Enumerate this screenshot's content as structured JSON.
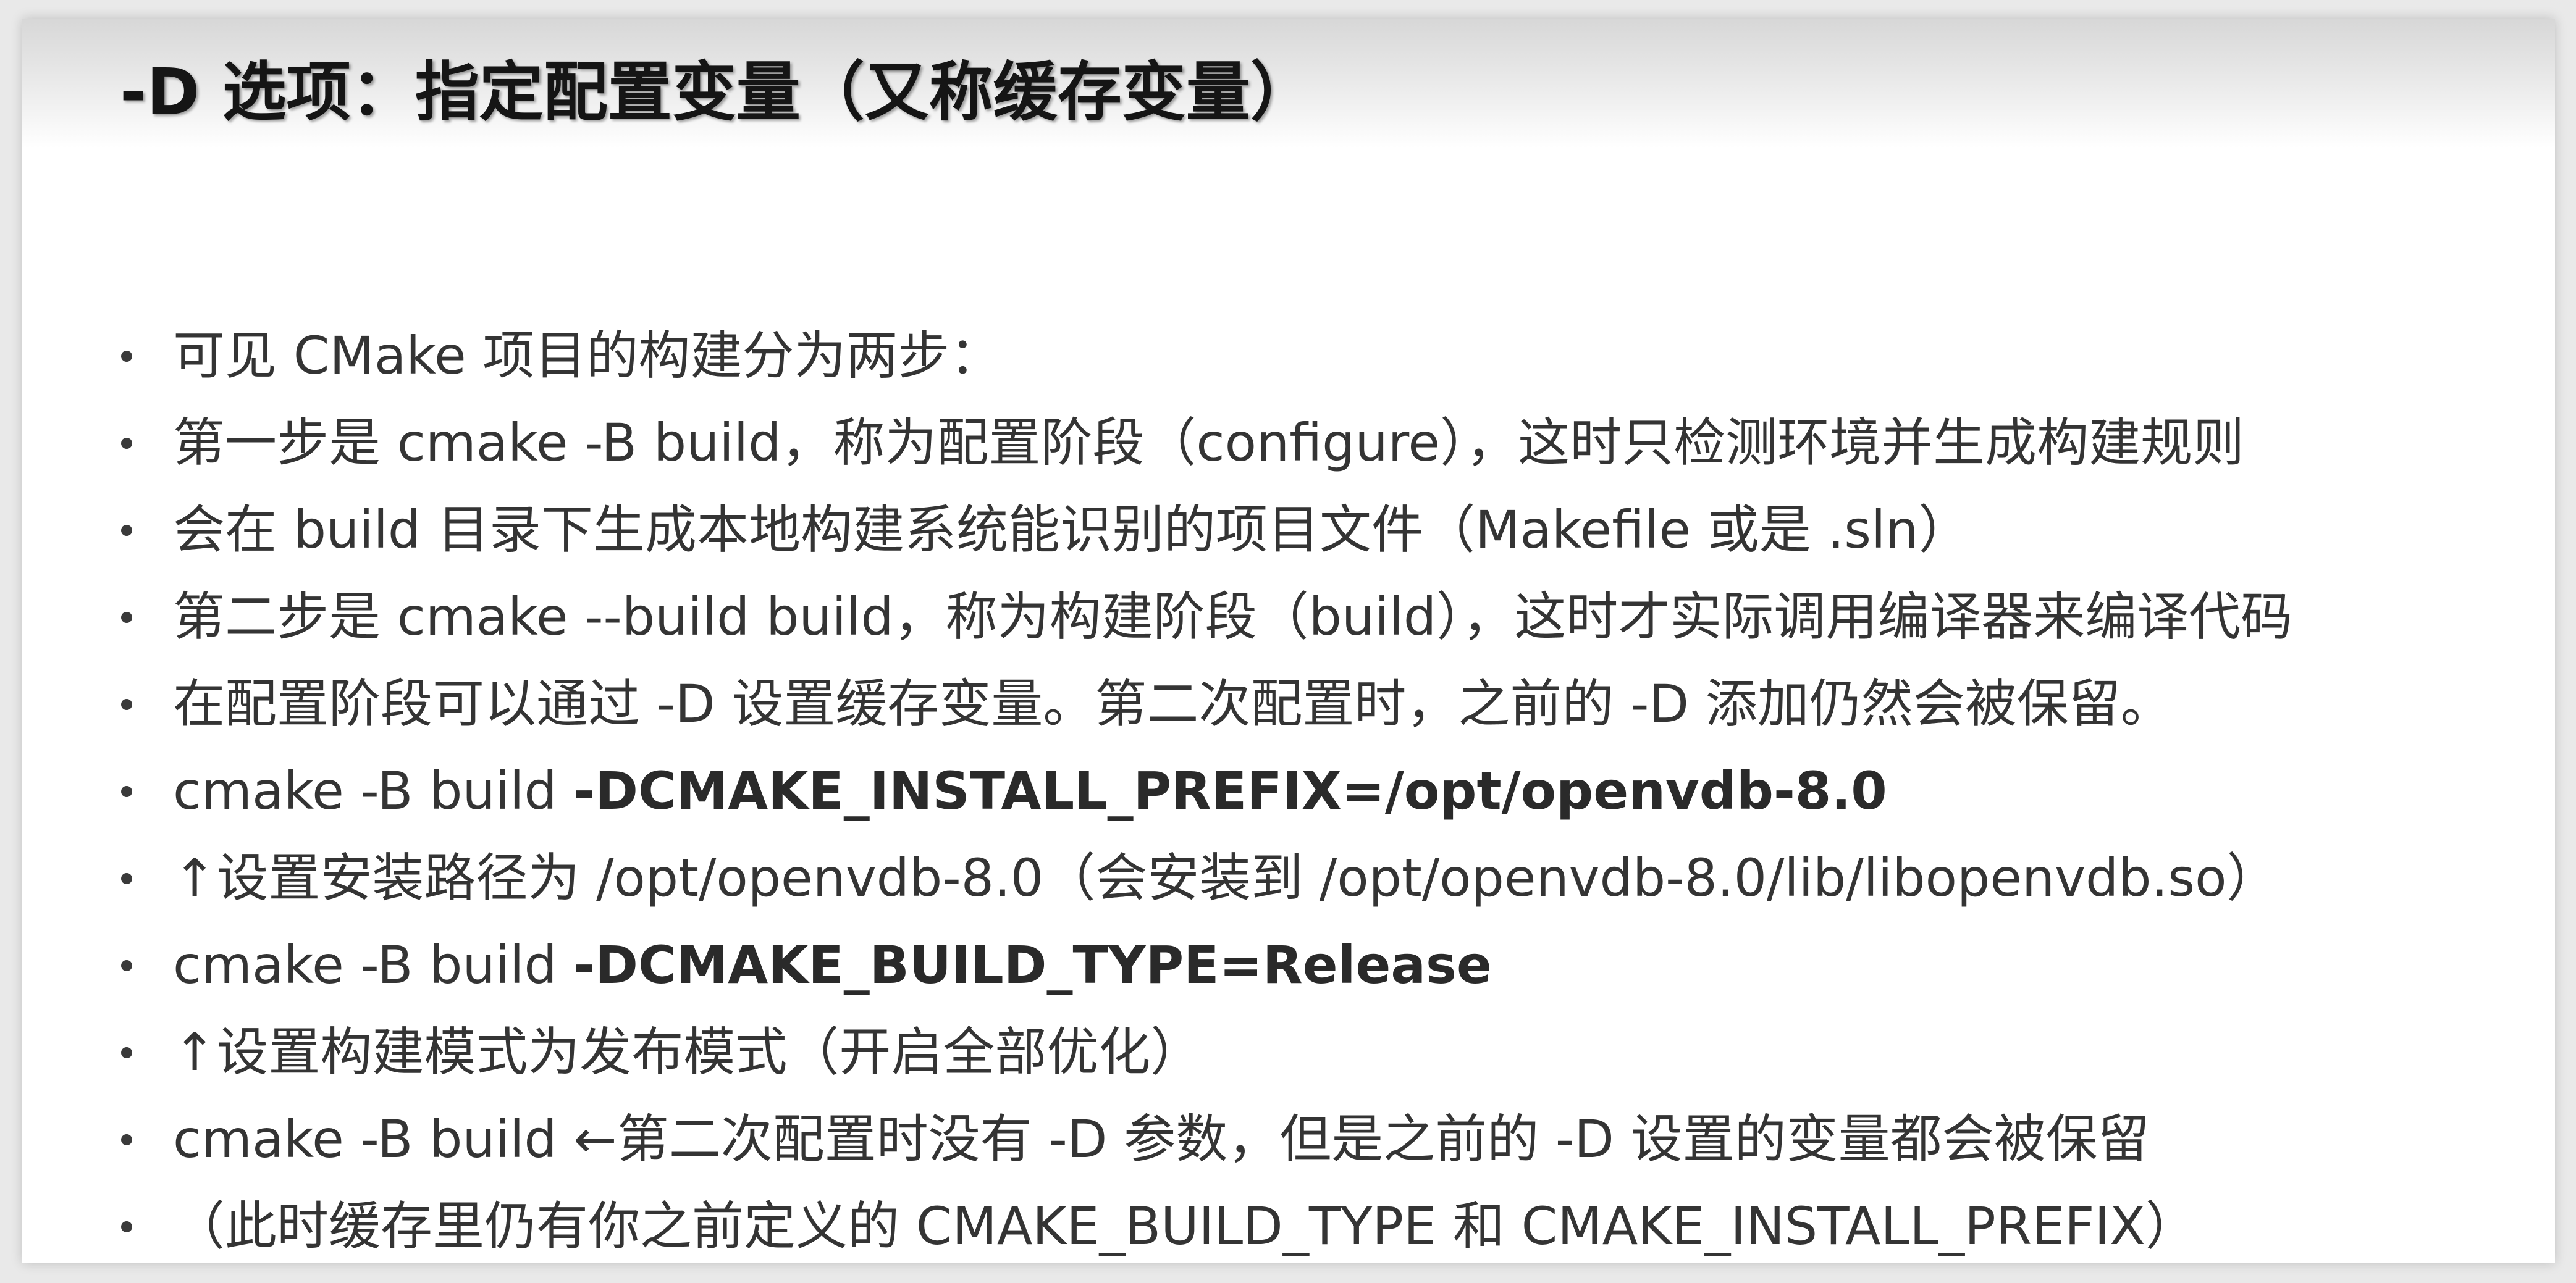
{
  "slide": {
    "title": "-D 选项：指定配置变量（又称缓存变量）",
    "bullets": [
      {
        "text": "可见 CMake 项目的构建分为两步：",
        "bold": ""
      },
      {
        "text": "第一步是 cmake -B build，称为配置阶段（configure），这时只检测环境并生成构建规则",
        "bold": ""
      },
      {
        "text": "会在 build 目录下生成本地构建系统能识别的项目文件（Makefile 或是 .sln）",
        "bold": ""
      },
      {
        "text": "第二步是 cmake --build build，称为构建阶段（build），这时才实际调用编译器来编译代码",
        "bold": ""
      },
      {
        "text": "在配置阶段可以通过 -D 设置缓存变量。第二次配置时，之前的 -D 添加仍然会被保留。",
        "bold": ""
      },
      {
        "text": "cmake -B build ",
        "bold": "-DCMAKE_INSTALL_PREFIX=/opt/openvdb-8.0"
      },
      {
        "text": "↑设置安装路径为 /opt/openvdb-8.0（会安装到 /opt/openvdb-8.0/lib/libopenvdb.so）",
        "bold": ""
      },
      {
        "text": "cmake -B build ",
        "bold": "-DCMAKE_BUILD_TYPE=Release"
      },
      {
        "text": "↑设置构建模式为发布模式（开启全部优化）",
        "bold": ""
      },
      {
        "text": "cmake -B build   ←第二次配置时没有 -D 参数，但是之前的 -D 设置的变量都会被保留",
        "bold": ""
      },
      {
        "text": "（此时缓存里仍有你之前定义的 CMAKE_BUILD_TYPE 和 CMAKE_INSTALL_PREFIX）",
        "bold": ""
      }
    ]
  },
  "colors": {
    "background": "#e9e9e9",
    "slide": "#ffffff",
    "title_text": "#151515",
    "body_text": "#343434"
  }
}
